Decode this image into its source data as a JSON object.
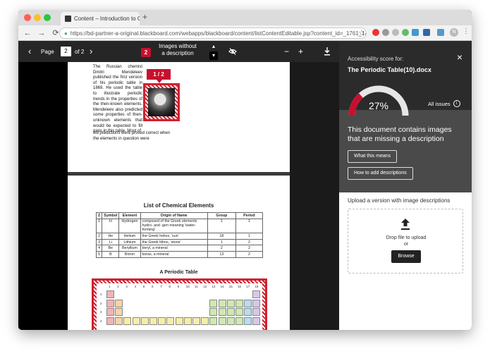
{
  "browser": {
    "tab_title": "Content – Introduction to Che",
    "tab_close": "×",
    "new_tab": "+",
    "url": "https://bd-partner-a-original.blackboard.com/webapps/blackboard/content/listContentEditable.jsp?content_id=_1761_1&course_id=_1...",
    "back": "←",
    "forward": "→",
    "reload": "⟳",
    "star": "☆",
    "menu": "⋮",
    "avatar_initial": "N"
  },
  "viewer": {
    "page_label": "Page",
    "current_page": "2",
    "of_pages": "of 2",
    "issue_count": "2",
    "issue_label": "Images without a description",
    "zoom_out": "−",
    "zoom_in": "+"
  },
  "document": {
    "page1_text": "The Russian chemist Dmitri Mendeleev published the first version of his periodic table in 1869. He used the table to illustrate periodic trends in the properties of the then-known elements. Mendeleev also predicted some properties of then-unknown elements that would be expected to fill gaps in this table. Most of",
    "page1_tail": "his predictions were proved correct when the elements in question were",
    "marker_label": "1 / 2",
    "list_title": "List of Chemical Elements",
    "table_headers": [
      "Z",
      "Symbol",
      "Element",
      "Origin of Name",
      "Group",
      "Period"
    ],
    "table_rows": [
      [
        "1",
        "H",
        "Hydrogen",
        "composed of the Greek elements hydro- and -gen meaning 'water-forming'",
        "1",
        "1"
      ],
      [
        "2",
        "He",
        "Helium",
        "the Greek helios, 'sun'",
        "18",
        "1"
      ],
      [
        "3",
        "Li",
        "Lithium",
        "the Greek lithos, 'stone'",
        "1",
        "2"
      ],
      [
        "4",
        "Be",
        "Beryllium",
        "beryl, a mineral",
        "2",
        "2"
      ],
      [
        "5",
        "B",
        "Boron",
        "borax, a mineral",
        "13",
        "2"
      ]
    ],
    "periodic_title": "A Periodic Table",
    "group_numbers": [
      "1",
      "2",
      "3",
      "4",
      "5",
      "6",
      "7",
      "8",
      "9",
      "10",
      "11",
      "12",
      "13",
      "14",
      "15",
      "16",
      "17",
      "18"
    ],
    "period_numbers": [
      "1",
      "2",
      "3",
      "4"
    ]
  },
  "panel": {
    "score_label": "Accessibility score for:",
    "filename": "The Periodic Table(10).docx",
    "score": 27,
    "score_text": "27%",
    "all_issues": "All issues",
    "info": "i",
    "message": "This document contains images that are missing a description",
    "what_means": "What this means",
    "how_to": "How to add descriptions",
    "upload_title": "Upload a version with image descriptions",
    "drop_text": "Drop file to upload",
    "or_text": "or",
    "browse": "Browse",
    "close": "×"
  },
  "colors": {
    "accent_red": "#c8102e",
    "panel_dark": "#2b2b2b",
    "panel_mid": "#4a4a4a"
  }
}
